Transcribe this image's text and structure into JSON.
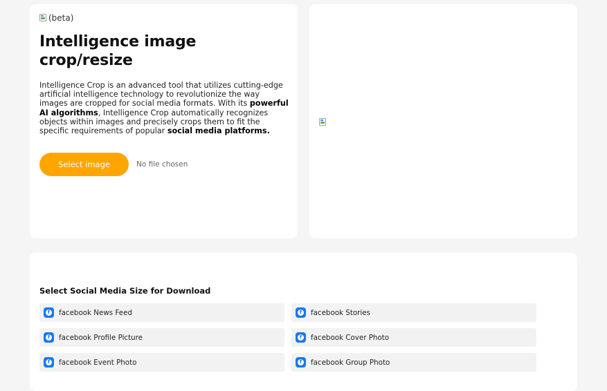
{
  "intro": {
    "beta_label": "(beta)",
    "title": "Intelligence image crop/resize",
    "description": {
      "part1": "Intelligence Crop is an advanced tool that utilizes cutting-edge artificial intelligence technology to revolutionize the way images are cropped for social media formats. With its ",
      "bold1": "powerful AI algorithms",
      "part2": ", Intelligence Crop automatically recognizes objects within images and precisely crops them to fit the specific requirements of popular ",
      "bold2": "social media platforms."
    },
    "select_button_label": "Select image",
    "file_status": "No file chosen"
  },
  "download": {
    "heading": "Select Social Media Size for Download",
    "options": [
      {
        "label": "facebook News Feed",
        "icon": "facebook-icon"
      },
      {
        "label": "facebook Stories",
        "icon": "facebook-icon"
      },
      {
        "label": "facebook Profile Picture",
        "icon": "facebook-icon"
      },
      {
        "label": "facebook Cover Photo",
        "icon": "facebook-icon"
      },
      {
        "label": "facebook Event Photo",
        "icon": "facebook-icon"
      },
      {
        "label": "facebook Group Photo",
        "icon": "facebook-icon"
      }
    ]
  },
  "colors": {
    "accent": "#ffa500",
    "facebook": "#1877f2",
    "background": "#f5f5f5"
  }
}
